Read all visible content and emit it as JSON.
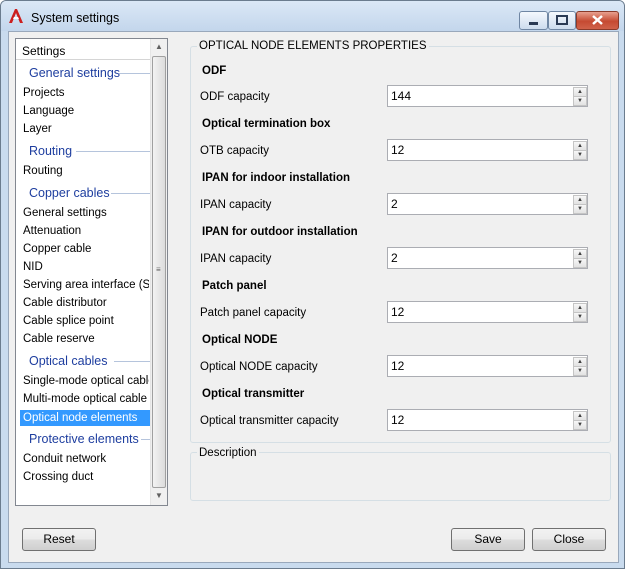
{
  "window": {
    "title": "System settings",
    "minimize_icon": "minimize-icon",
    "maximize_icon": "maximize-icon",
    "close_icon": "close-icon"
  },
  "nav": {
    "header": "Settings",
    "groups": [
      {
        "label": "General settings",
        "items": [
          "Projects",
          "Language",
          "Layer"
        ]
      },
      {
        "label": "Routing",
        "items": [
          "Routing"
        ]
      },
      {
        "label": "Copper cables",
        "items": [
          "General settings",
          "Attenuation",
          "Copper cable",
          "NID",
          "Serving area interface (S...",
          "Cable distributor",
          "Cable splice point",
          "Cable reserve"
        ]
      },
      {
        "label": "Optical cables",
        "items": [
          "Single-mode optical cable",
          "Multi-mode optical cable",
          "Optical node elements"
        ]
      },
      {
        "label": "Protective elements",
        "items": [
          "Conduit network",
          "Crossing duct"
        ]
      }
    ],
    "selected": "Optical node elements"
  },
  "main": {
    "group_title": "OPTICAL NODE ELEMENTS PROPERTIES",
    "sections": [
      {
        "heading": "ODF",
        "label": "ODF capacity",
        "value": "144"
      },
      {
        "heading": "Optical termination box",
        "label": "OTB capacity",
        "value": "12"
      },
      {
        "heading": "IPAN  for indoor installation",
        "label": "IPAN capacity",
        "value": "2"
      },
      {
        "heading": "IPAN  for outdoor installation",
        "label": "IPAN capacity",
        "value": "2"
      },
      {
        "heading": "Patch panel",
        "label": "Patch panel capacity",
        "value": "12"
      },
      {
        "heading": "Optical NODE",
        "label": "Optical NODE capacity",
        "value": "12"
      },
      {
        "heading": "Optical transmitter",
        "label": "Optical transmitter capacity",
        "value": "12"
      }
    ],
    "description_title": "Description"
  },
  "buttons": {
    "reset": "Reset",
    "save": "Save",
    "close": "Close"
  }
}
